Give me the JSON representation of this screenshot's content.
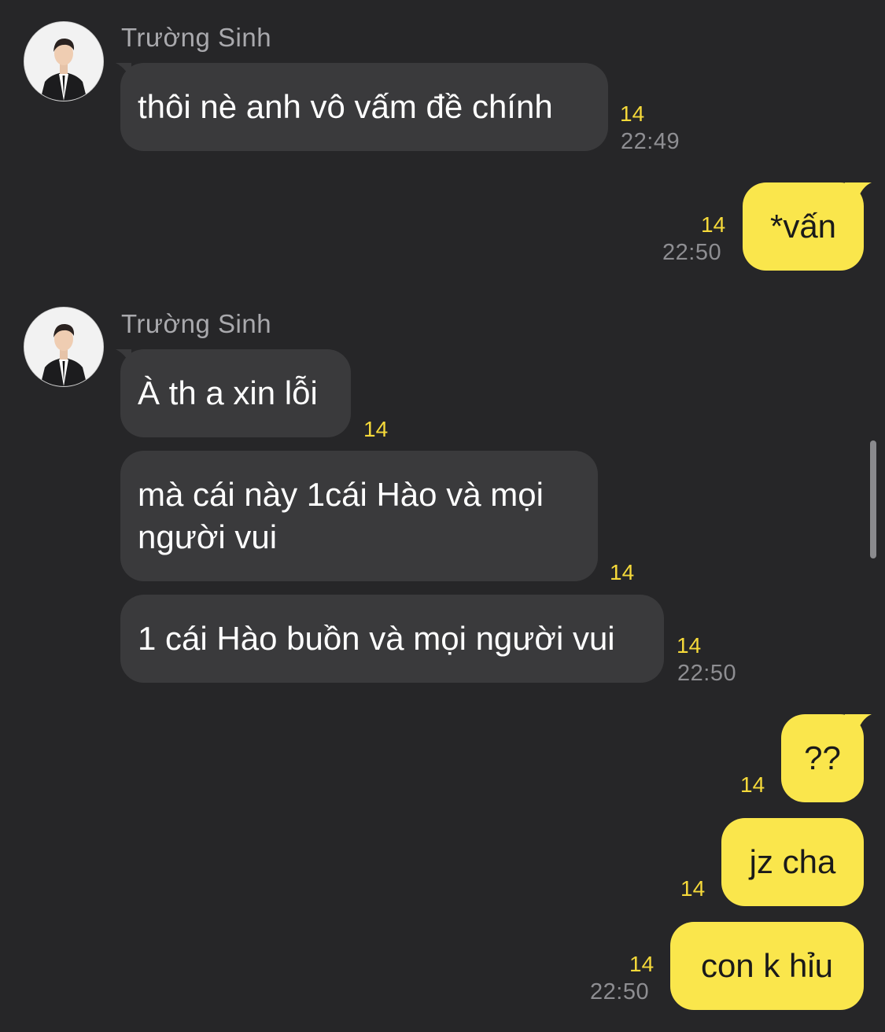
{
  "conversation": {
    "sender_name": "Trường Sinh",
    "messages": [
      {
        "side": "left",
        "text": "thôi nè anh vô vấm đề chính",
        "unread": "14",
        "time": "22:49"
      },
      {
        "side": "right",
        "text": "*vấn",
        "unread": "14",
        "time": "22:50"
      },
      {
        "side": "left",
        "text": "À th a xin lỗi",
        "unread": "14"
      },
      {
        "side": "left",
        "text": "mà cái này 1cái Hào và mọi người vui",
        "unread": "14"
      },
      {
        "side": "left",
        "text": "1 cái Hào buồn và mọi người vui",
        "unread": "14",
        "time": "22:50"
      },
      {
        "side": "right",
        "text": "??",
        "unread": "14"
      },
      {
        "side": "right",
        "text": "jz cha",
        "unread": "14"
      },
      {
        "side": "right",
        "text": "con k hỉu",
        "unread": "14",
        "time": "22:50"
      }
    ]
  },
  "colors": {
    "background": "#262628",
    "incoming_bubble": "#3a3a3c",
    "outgoing_bubble": "#fae64c",
    "unread_count": "#f5d93a",
    "timestamp": "#8e8e92"
  }
}
